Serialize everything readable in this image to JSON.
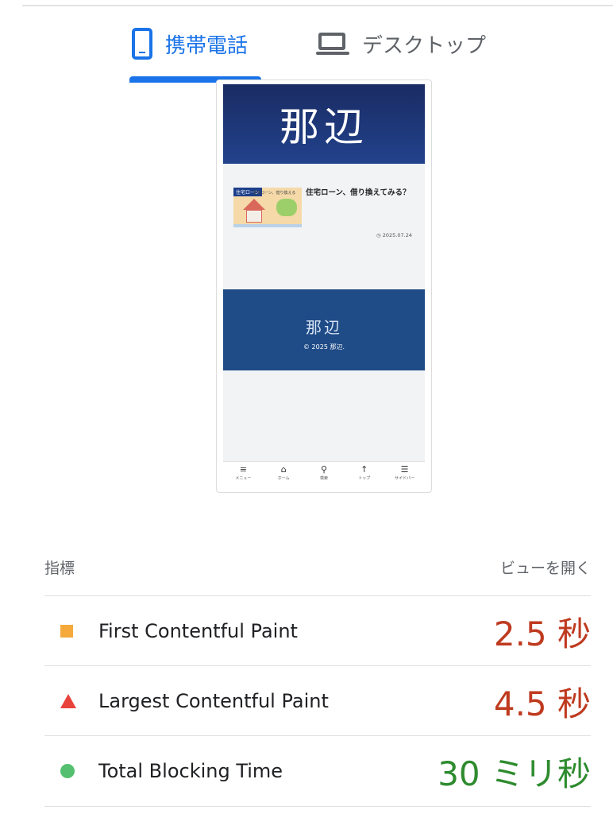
{
  "tabs": {
    "mobile_label": "携帯電話",
    "desktop_label": "デスクトップ",
    "active": "mobile"
  },
  "preview": {
    "logo": "那辺",
    "post": {
      "thumb_tag": "住宅ローン",
      "thumb_caption": "住宅ローン、借り換える",
      "title": "住宅ローン、借り換えてみる？",
      "date": "◷ 2025.07.24"
    },
    "footer": {
      "logo": "那辺",
      "copyright": "© 2025 那辺."
    },
    "nav": [
      {
        "icon": "menu-icon",
        "glyph": "≡",
        "label": "メニュー"
      },
      {
        "icon": "home-icon",
        "glyph": "⌂",
        "label": "ホーム"
      },
      {
        "icon": "search-icon",
        "glyph": "⚲",
        "label": "検索"
      },
      {
        "icon": "arrow-up-icon",
        "glyph": "↑",
        "label": "トップ"
      },
      {
        "icon": "sidebar-icon",
        "glyph": "☰",
        "label": "サイドバー"
      }
    ]
  },
  "metrics": {
    "header_left": "指標",
    "header_right": "ビューを開く",
    "items": [
      {
        "label": "First Contentful Paint",
        "value": "2.5 秒",
        "status": "average",
        "color": "#f4a93a"
      },
      {
        "label": "Largest Contentful Paint",
        "value": "4.5 秒",
        "status": "poor",
        "color": "#e8433b"
      },
      {
        "label": "Total Blocking Time",
        "value": "30 ミリ秒",
        "status": "good",
        "color": "#54c06f"
      }
    ]
  },
  "colors": {
    "accent": "#1a73e8",
    "value_poor": "#bf3a1f",
    "value_good": "#2e8b2e"
  }
}
